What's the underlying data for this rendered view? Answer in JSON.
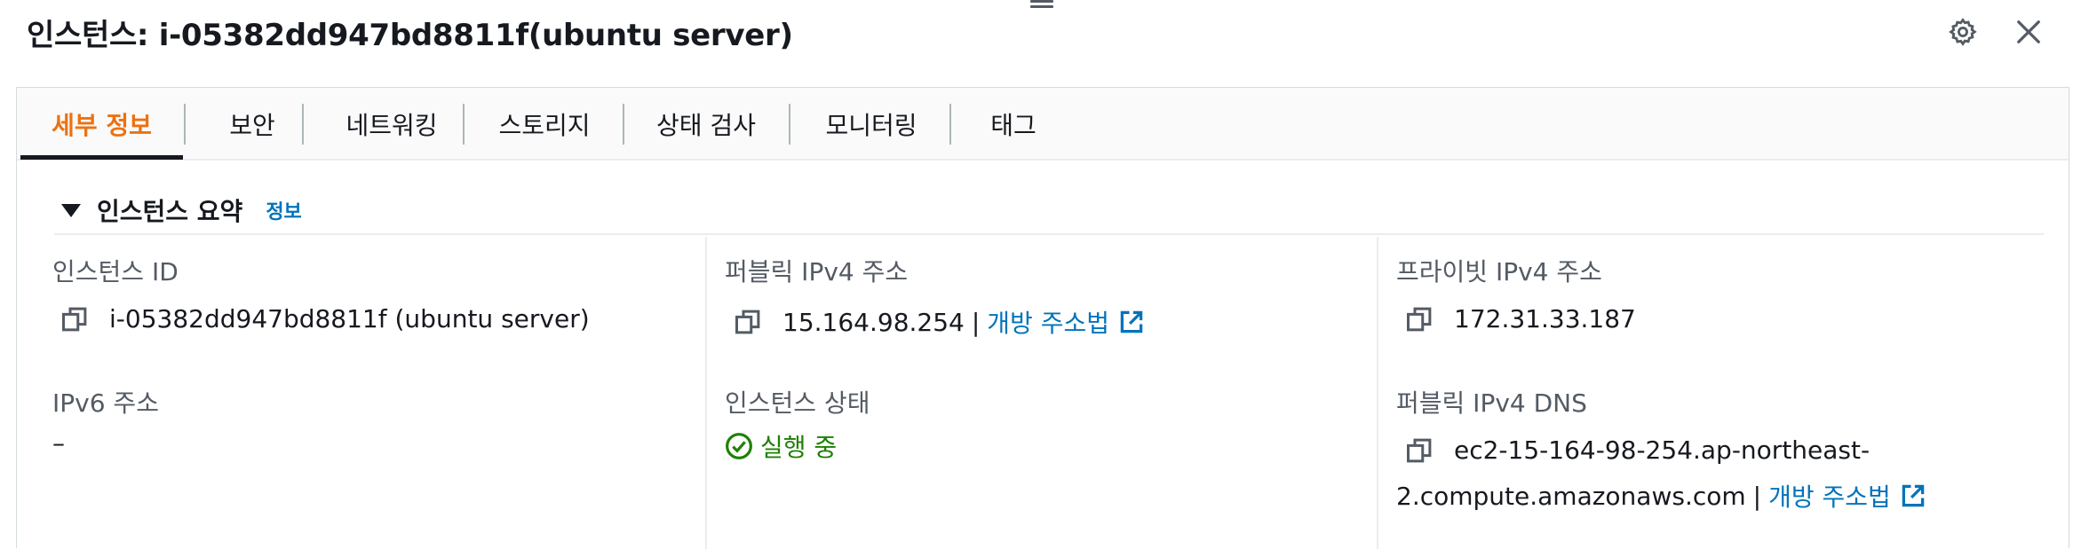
{
  "header": {
    "title": "인스턴스: i-05382dd947bd8811f(ubuntu server)"
  },
  "tabs": [
    {
      "label": "세부 정보",
      "active": true
    },
    {
      "label": "보안"
    },
    {
      "label": "네트워킹"
    },
    {
      "label": "스토리지"
    },
    {
      "label": "상태 검사"
    },
    {
      "label": "모니터링"
    },
    {
      "label": "태그"
    }
  ],
  "summary": {
    "title": "인스턴스 요약",
    "info_link": "정보"
  },
  "fields": {
    "instance_id": {
      "label": "인스턴스 ID",
      "value": "i-05382dd947bd8811f (ubuntu server)"
    },
    "public_ipv4": {
      "label": "퍼블릭 IPv4 주소",
      "value": "15.164.98.254",
      "link": "개방 주소법"
    },
    "private_ipv4": {
      "label": "프라이빗 IPv4 주소",
      "value": "172.31.33.187"
    },
    "ipv6": {
      "label": "IPv6 주소",
      "value": "–"
    },
    "instance_state": {
      "label": "인스턴스 상태",
      "value": "실행 중"
    },
    "public_dns": {
      "label": "퍼블릭 IPv4 DNS",
      "value_line1": "ec2-15-164-98-254.ap-northeast-",
      "value_line2": "2.compute.amazonaws.com",
      "link": "개방 주소법"
    }
  },
  "colors": {
    "accent": "#ec7211",
    "link": "#0073bb",
    "success": "#1d8102",
    "text": "#16191f",
    "muted": "#545b64"
  },
  "icons": {
    "settings": "gear-icon",
    "close": "close-icon",
    "copy": "copy-icon",
    "external": "external-link-icon",
    "status": "check-circle-icon",
    "collapse": "caret-down-icon"
  }
}
